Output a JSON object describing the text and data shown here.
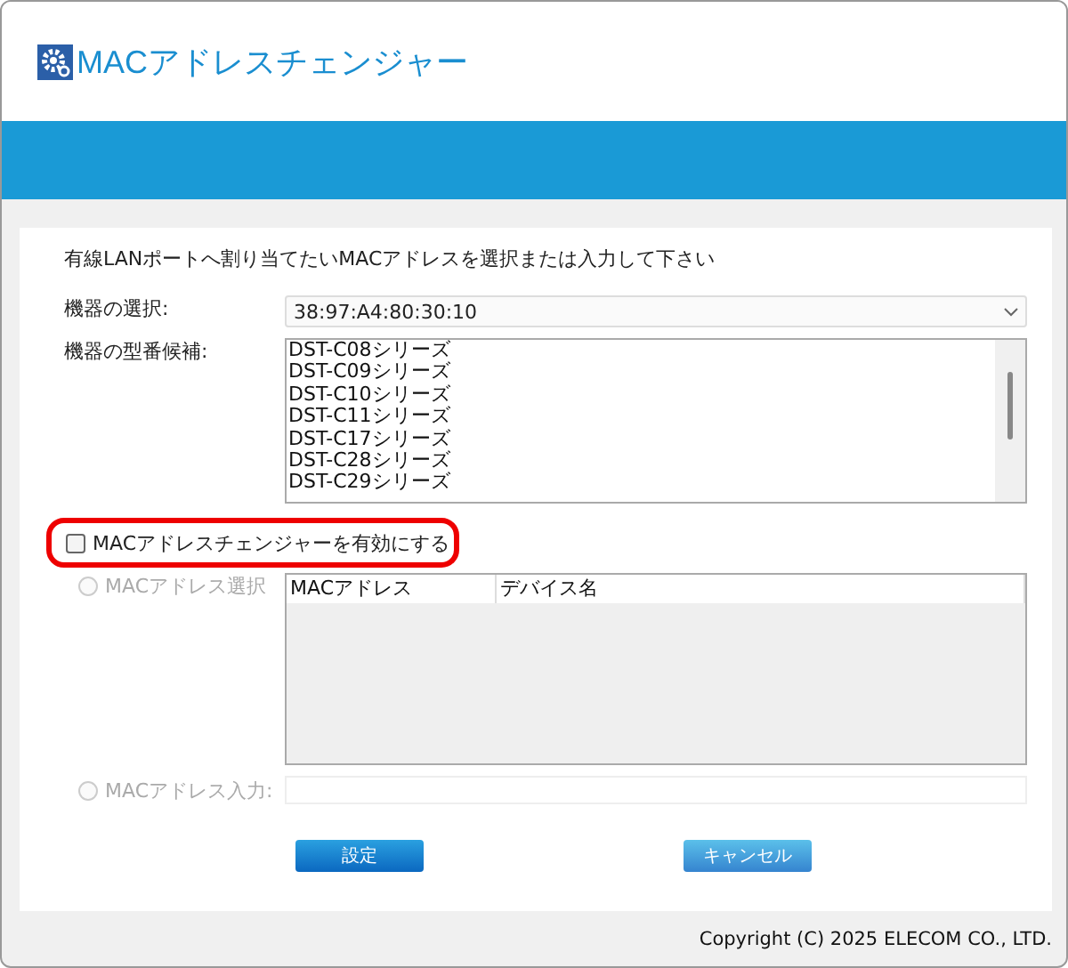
{
  "window": {
    "title": "MACアドレスチェンジャー"
  },
  "instruction": "有線LANポートへ割り当てたいMACアドレスを選択または入力して下さい",
  "device_select": {
    "label": "機器の選択:",
    "value": "38:97:A4:80:30:10"
  },
  "model_candidates": {
    "label": "機器の型番候補:",
    "items": [
      "DST-C08シリーズ",
      "DST-C09シリーズ",
      "DST-C10シリーズ",
      "DST-C11シリーズ",
      "DST-C17シリーズ",
      "DST-C28シリーズ",
      "DST-C29シリーズ"
    ]
  },
  "enable_checkbox": {
    "label": "MACアドレスチェンジャーを有効にする",
    "checked": false
  },
  "options": [
    {
      "label": "MACアドレス選択",
      "kind": "table",
      "selected": false,
      "disabled": true
    },
    {
      "label": "MACアドレス入力:",
      "kind": "input",
      "selected": false,
      "disabled": true
    }
  ],
  "table": {
    "columns": [
      "MACアドレス",
      "デバイス名"
    ]
  },
  "buttons": [
    {
      "label": "設定",
      "kind": "primary"
    },
    {
      "label": "キャンセル",
      "kind": "secondary"
    }
  ],
  "footer": "Copyright (C) 2025 ELECOM CO., LTD."
}
